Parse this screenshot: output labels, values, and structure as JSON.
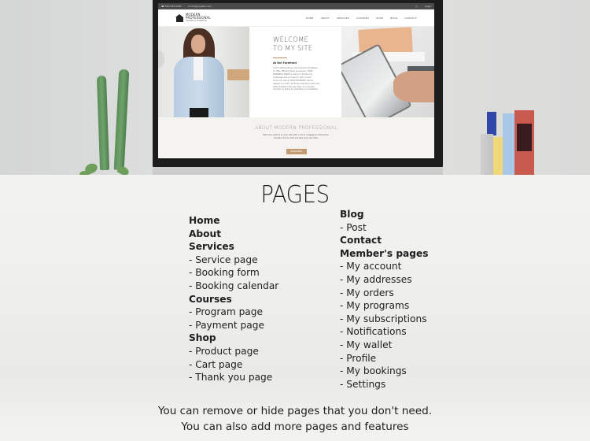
{
  "mockup": {
    "site": {
      "topbar": {
        "phone": "☎ 555-555-5555",
        "email": "✉ info@mysite.com",
        "right_items": [
          "cart",
          "login"
        ],
        "login_label": "Login"
      },
      "logo": {
        "line1": "MODERN",
        "line2": "PROFESSIONAL",
        "tagline": "WOMEN & BUSINESS"
      },
      "nav": [
        "HOME",
        "ABOUT",
        "SERVICES",
        "COURSES",
        "SHOP",
        "BLOG",
        "CONTACT"
      ],
      "hero": {
        "title_line1": "WELCOME",
        "title_line2": "TO MY SITE",
        "subtitle": "At the Forefront",
        "body": "I am implementing new business strategies to offer efficient work processes. YOUR BUSINESS NAME is ready to tackle any challenge and succeed in the current economy. Since YEAR FOUNDED, we've helped our CITY clients by delivering services that transform the way they do business. Contact us today to schedule a consultation."
      },
      "about": {
        "title": "ABOUT MODERN PROFESSIONAL",
        "text_line1": "Welcome visitors to your site with a short, engaging introduction.",
        "text_line2": "Double click to edit and add your own text.",
        "button_label": "READ MORE"
      }
    }
  },
  "pages_section": {
    "title": "PAGES",
    "left_column": [
      {
        "label": "Home",
        "type": "heading"
      },
      {
        "label": "About",
        "type": "heading"
      },
      {
        "label": "Services",
        "type": "heading"
      },
      {
        "label": "- Service page",
        "type": "sub"
      },
      {
        "label": "- Booking form",
        "type": "sub"
      },
      {
        "label": "- Booking calendar",
        "type": "sub"
      },
      {
        "label": "Courses",
        "type": "heading"
      },
      {
        "label": "- Program page",
        "type": "sub"
      },
      {
        "label": "- Payment page",
        "type": "sub"
      },
      {
        "label": "Shop",
        "type": "heading"
      },
      {
        "label": "- Product page",
        "type": "sub"
      },
      {
        "label": "- Cart page",
        "type": "sub"
      },
      {
        "label": "- Thank you page",
        "type": "sub"
      }
    ],
    "right_column": [
      {
        "label": "Blog",
        "type": "heading"
      },
      {
        "label": "- Post",
        "type": "sub"
      },
      {
        "label": "Contact",
        "type": "heading"
      },
      {
        "label": "Member's pages",
        "type": "heading"
      },
      {
        "label": "- My account",
        "type": "sub"
      },
      {
        "label": "- My addresses",
        "type": "sub"
      },
      {
        "label": "- My orders",
        "type": "sub"
      },
      {
        "label": "- My programs",
        "type": "sub"
      },
      {
        "label": "- My subscriptions",
        "type": "sub"
      },
      {
        "label": "- Notifications",
        "type": "sub"
      },
      {
        "label": "- My wallet",
        "type": "sub"
      },
      {
        "label": "- Profile",
        "type": "sub"
      },
      {
        "label": "- My bookings",
        "type": "sub"
      },
      {
        "label": "- Settings",
        "type": "sub"
      }
    ],
    "footer_line1": "You can remove or hide pages that you don't need.",
    "footer_line2": "You can also add more pages and features"
  },
  "colors": {
    "accent": "#c49a73",
    "text": "#1e1e1e",
    "topbar": "#4a4a4a",
    "about_bg": "#f5f3ef"
  }
}
